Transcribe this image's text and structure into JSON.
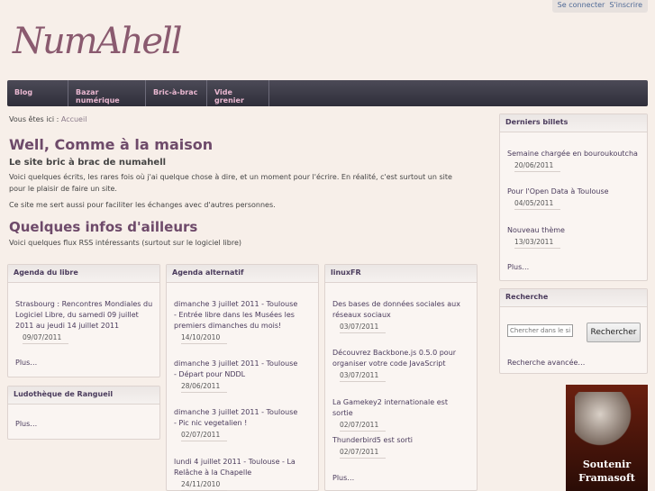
{
  "topbar": {
    "login": "Se connecter",
    "signup": "S'inscrire"
  },
  "logo": {
    "text": "NumAhell"
  },
  "nav": [
    "Blog",
    "Bazar numérique",
    "Bric-à-brac",
    "Vide grenier"
  ],
  "breadcrumb": {
    "prefix": "Vous êtes ici :",
    "link": "Accueil"
  },
  "main": {
    "title": "Well, Comme à la maison",
    "subtitle": "Le site bric à brac de numahell",
    "intro1": "Voici quelques écrits, les rares fois où j'ai quelque chose à dire, et un moment pour l'écrire. En réalité, c'est surtout un site pour le plaisir de faire un site.",
    "intro2": "Ce site me sert aussi pour faciliter les échanges avec d'autres personnes.",
    "section_title": "Quelques infos d'ailleurs",
    "section_intro": "Voici quelques flux RSS intéressants (surtout sur le logiciel libre)"
  },
  "feeds": {
    "agenda_libre": {
      "title": "Agenda du libre",
      "items": [
        {
          "text": "Strasbourg : Rencontres Mondiales du Logiciel Libre, du samedi 09 juillet 2011 au jeudi 14 juillet 2011",
          "date": "09/07/2011"
        }
      ],
      "more": "Plus…"
    },
    "ludotheque": {
      "title": "Ludothèque de Rangueil",
      "more": "Plus…"
    },
    "agenda_alternatif": {
      "title": "Agenda alternatif",
      "items": [
        {
          "text": "dimanche 3 juillet 2011 - Toulouse - Entrée libre dans les Musées les premiers dimanches du mois!",
          "date": "14/10/2010"
        },
        {
          "text": "dimanche 3 juillet 2011 - Toulouse - Départ pour NDDL",
          "date": "28/06/2011"
        },
        {
          "text": "dimanche 3 juillet 2011 - Toulouse - Pic nic vegetalien !",
          "date": "02/07/2011"
        },
        {
          "text": "lundi 4 juillet 2011 - Toulouse - La Relâche à la Chapelle",
          "date": "24/11/2010"
        }
      ]
    },
    "linuxfr": {
      "title": "linuxFR",
      "items": [
        {
          "text": "Des bases de données sociales aux réseaux sociaux",
          "date": "03/07/2011"
        },
        {
          "text": "Découvrez Backbone.js 0.5.0 pour organiser votre code JavaScript",
          "date": "03/07/2011"
        },
        {
          "text": "La Gamekey2 internationale est sortie",
          "date": "02/07/2011"
        },
        {
          "text": "Thunderbird5 est sorti",
          "date": "02/07/2011"
        }
      ],
      "more": "Plus…"
    }
  },
  "sidebar": {
    "recent": {
      "title": "Derniers billets",
      "items": [
        {
          "text": "Semaine chargée en bouroukoutcha",
          "date": "20/06/2011"
        },
        {
          "text": "Pour l'Open Data à Toulouse",
          "date": "04/05/2011"
        },
        {
          "text": "Nouveau thème",
          "date": "13/03/2011"
        }
      ],
      "more": "Plus…"
    },
    "search": {
      "title": "Recherche",
      "placeholder": "Chercher dans le site",
      "button": "Rechercher",
      "advanced": "Recherche avancée…"
    },
    "banner": {
      "line1": "Soutenir",
      "line2": "Framasoft"
    }
  }
}
